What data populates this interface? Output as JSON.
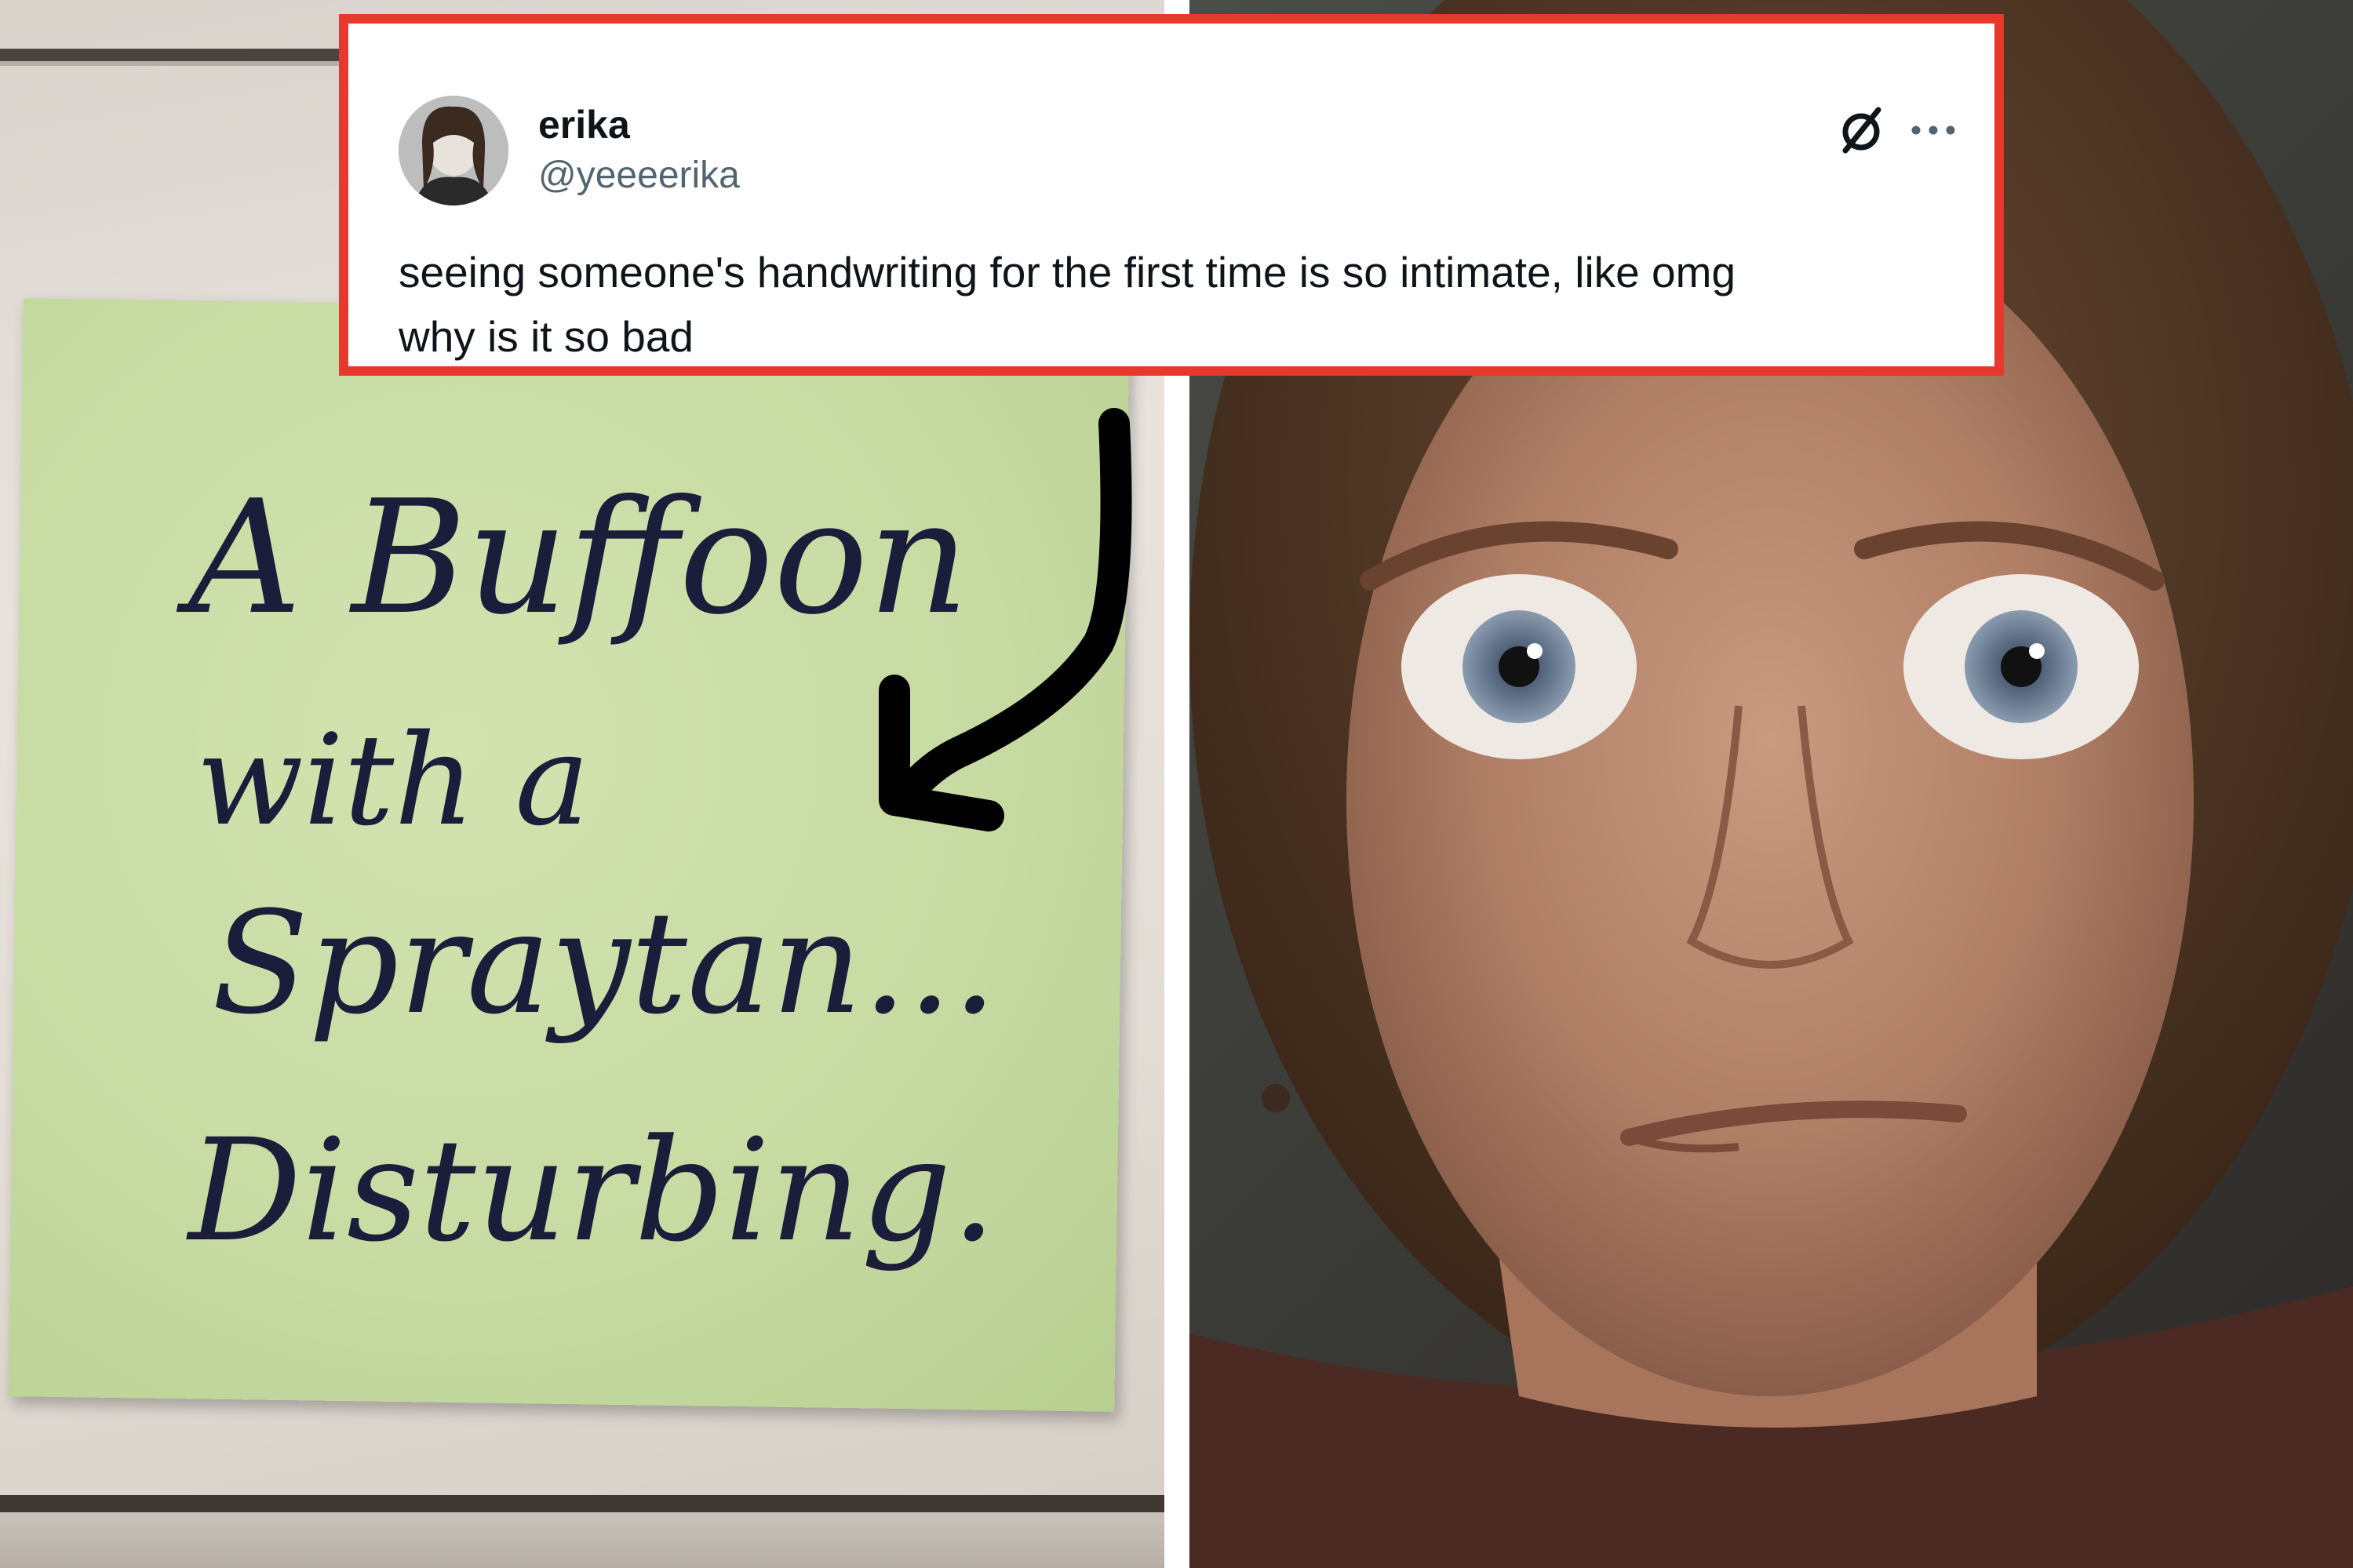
{
  "tweet": {
    "display_name": "erika",
    "handle": "@yeeeerika",
    "text_line1": "seeing someone's handwriting for the first time is so intimate, like omg",
    "text_line2": "why is it so bad",
    "avatar_icon": "profile-photo",
    "brand_icon": "x-logo-icon",
    "menu_icon": "more-options-icon",
    "border_color": "#e8372c"
  },
  "sticky_note": {
    "line1": "A Buffoon",
    "line2": "with a",
    "line3": "Spraytan...",
    "line4": "Disturbing.",
    "note_color": "#c7dba3",
    "ink_color": "#1b1d3a"
  },
  "arrow": {
    "icon": "curved-arrow-icon",
    "color": "#000000"
  },
  "reaction_image": {
    "icon": "wide-eyed-face-photo"
  }
}
